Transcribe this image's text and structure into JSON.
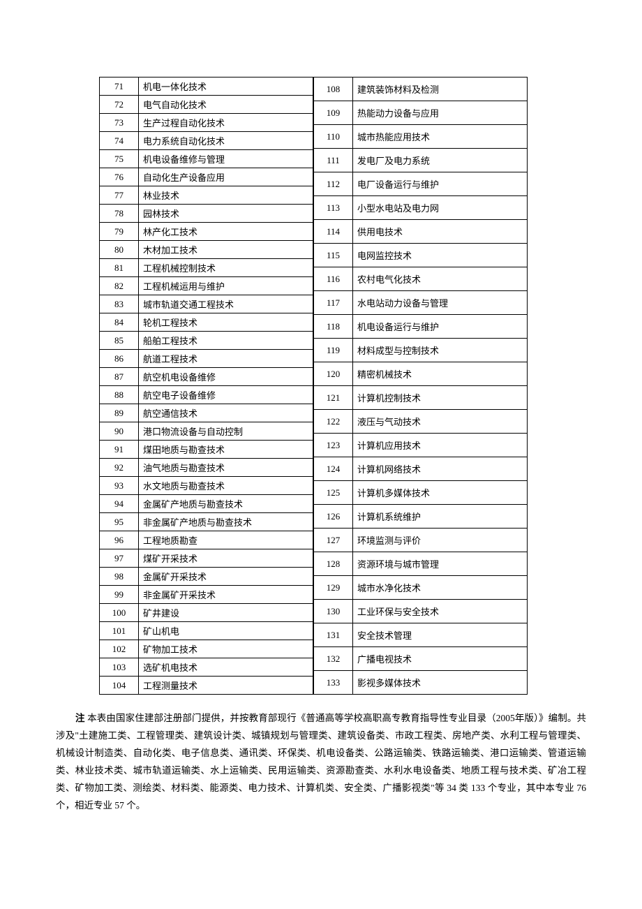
{
  "left_table": [
    {
      "num": "71",
      "name": "机电一体化技术"
    },
    {
      "num": "72",
      "name": "电气自动化技术"
    },
    {
      "num": "73",
      "name": "生产过程自动化技术"
    },
    {
      "num": "74",
      "name": "电力系统自动化技术"
    },
    {
      "num": "75",
      "name": "机电设备维修与管理"
    },
    {
      "num": "76",
      "name": "自动化生产设备应用"
    },
    {
      "num": "77",
      "name": "林业技术"
    },
    {
      "num": "78",
      "name": "园林技术"
    },
    {
      "num": "79",
      "name": "林产化工技术"
    },
    {
      "num": "80",
      "name": "木材加工技术"
    },
    {
      "num": "81",
      "name": "工程机械控制技术"
    },
    {
      "num": "82",
      "name": "工程机械运用与维护"
    },
    {
      "num": "83",
      "name": "城市轨道交通工程技术"
    },
    {
      "num": "84",
      "name": "轮机工程技术"
    },
    {
      "num": "85",
      "name": "船舶工程技术"
    },
    {
      "num": "86",
      "name": "航道工程技术"
    },
    {
      "num": "87",
      "name": "航空机电设备维修"
    },
    {
      "num": "88",
      "name": "航空电子设备维修"
    },
    {
      "num": "89",
      "name": "航空通信技术"
    },
    {
      "num": "90",
      "name": "港口物流设备与自动控制"
    },
    {
      "num": "91",
      "name": "煤田地质与勘查技术"
    },
    {
      "num": "92",
      "name": "油气地质与勘查技术"
    },
    {
      "num": "93",
      "name": "水文地质与勘查技术"
    },
    {
      "num": "94",
      "name": "金属矿产地质与勘查技术"
    },
    {
      "num": "95",
      "name": "非金属矿产地质与勘查技术"
    },
    {
      "num": "96",
      "name": "工程地质勘查"
    },
    {
      "num": "97",
      "name": "煤矿开采技术"
    },
    {
      "num": "98",
      "name": "金属矿开采技术"
    },
    {
      "num": "99",
      "name": "非金属矿开采技术"
    },
    {
      "num": "100",
      "name": "矿井建设"
    },
    {
      "num": "101",
      "name": "矿山机电"
    },
    {
      "num": "102",
      "name": "矿物加工技术"
    },
    {
      "num": "103",
      "name": "选矿机电技术"
    },
    {
      "num": "104",
      "name": "工程测量技术"
    }
  ],
  "right_table": [
    {
      "num": "108",
      "name": "建筑装饰材料及检测"
    },
    {
      "num": "109",
      "name": "热能动力设备与应用"
    },
    {
      "num": "110",
      "name": "城市热能应用技术"
    },
    {
      "num": "111",
      "name": "发电厂及电力系统"
    },
    {
      "num": "112",
      "name": "电厂设备运行与维护"
    },
    {
      "num": "113",
      "name": "小型水电站及电力网"
    },
    {
      "num": "114",
      "name": "供用电技术"
    },
    {
      "num": "115",
      "name": "电网监控技术"
    },
    {
      "num": "116",
      "name": "农村电气化技术"
    },
    {
      "num": "117",
      "name": "水电站动力设备与管理"
    },
    {
      "num": "118",
      "name": "机电设备运行与维护"
    },
    {
      "num": "119",
      "name": "材料成型与控制技术"
    },
    {
      "num": "120",
      "name": "精密机械技术"
    },
    {
      "num": "121",
      "name": "计算机控制技术"
    },
    {
      "num": "122",
      "name": "液压与气动技术"
    },
    {
      "num": "123",
      "name": "计算机应用技术"
    },
    {
      "num": "124",
      "name": "计算机网络技术"
    },
    {
      "num": "125",
      "name": "计算机多媒体技术"
    },
    {
      "num": "126",
      "name": "计算机系统维护"
    },
    {
      "num": "127",
      "name": "环境监测与评价"
    },
    {
      "num": "128",
      "name": "资源环境与城市管理"
    },
    {
      "num": "129",
      "name": "城市水净化技术"
    },
    {
      "num": "130",
      "name": "工业环保与安全技术"
    },
    {
      "num": "131",
      "name": "安全技术管理"
    },
    {
      "num": "132",
      "name": "广播电视技术"
    },
    {
      "num": "133",
      "name": "影视多媒体技术"
    }
  ],
  "note_label": "注",
  "note_text": " 本表由国家住建部注册部门提供，并按教育部现行《普通高等学校高职高专教育指导性专业目录（2005年版）》编制。共涉及\"土建施工类、工程管理类、建筑设计类、城镇规划与管理类、建筑设备类、市政工程类、房地产类、水利工程与管理类、机械设计制造类、自动化类、电子信息类、通讯类、环保类、机电设备类、公路运输类、铁路运输类、港口运输类、管道运输类、林业技术类、城市轨道运输类、水上运输类、民用运输类、资源勘查类、水利水电设备类、地质工程与技术类、矿冶工程类、矿物加工类、测绘类、材料类、能源类、电力技术、计算机类、安全类、广播影视类\"等 34 类 133 个专业，其中本专业 76 个，相近专业 57 个。"
}
